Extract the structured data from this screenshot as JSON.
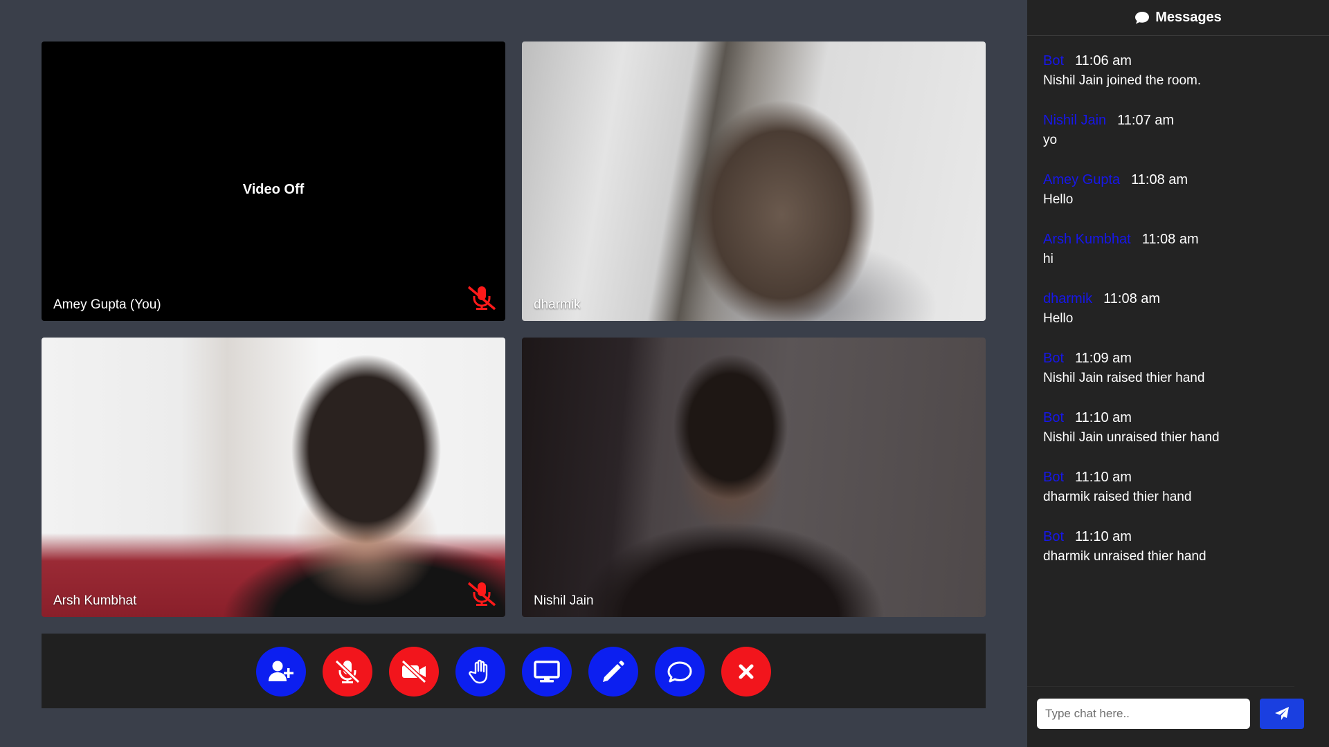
{
  "colors": {
    "page_bg": "#3a3f4a",
    "panel_bg": "#232323",
    "blue_button": "#0c1ff0",
    "red_button": "#f2151c",
    "sender_name": "#1717e8",
    "muted_icon": "#ff1a1a"
  },
  "participants": [
    {
      "name": "Amey Gupta (You)",
      "video_off_label": "Video Off",
      "muted": true
    },
    {
      "name": "dharmik",
      "muted": false
    },
    {
      "name": "Arsh Kumbhat",
      "muted": true
    },
    {
      "name": "Nishil Jain",
      "muted": false
    }
  ],
  "controls": [
    {
      "icon": "add-user-icon",
      "color": "blue"
    },
    {
      "icon": "microphone-slash-icon",
      "color": "red"
    },
    {
      "icon": "video-slash-icon",
      "color": "red"
    },
    {
      "icon": "raise-hand-icon",
      "color": "blue"
    },
    {
      "icon": "screen-share-icon",
      "color": "blue"
    },
    {
      "icon": "pencil-icon",
      "color": "blue"
    },
    {
      "icon": "chat-icon",
      "color": "blue"
    },
    {
      "icon": "close-icon",
      "color": "red"
    }
  ],
  "chat": {
    "title": "Messages",
    "messages": [
      {
        "sender": "Bot",
        "time": "11:06 am",
        "text": "Nishil Jain joined the room."
      },
      {
        "sender": "Nishil Jain",
        "time": "11:07 am",
        "text": "yo"
      },
      {
        "sender": "Amey Gupta",
        "time": "11:08 am",
        "text": "Hello"
      },
      {
        "sender": "Arsh Kumbhat",
        "time": "11:08 am",
        "text": "hi"
      },
      {
        "sender": "dharmik",
        "time": "11:08 am",
        "text": "Hello"
      },
      {
        "sender": "Bot",
        "time": "11:09 am",
        "text": "Nishil Jain raised thier hand"
      },
      {
        "sender": "Bot",
        "time": "11:10 am",
        "text": "Nishil Jain unraised thier hand"
      },
      {
        "sender": "Bot",
        "time": "11:10 am",
        "text": "dharmik raised thier hand"
      },
      {
        "sender": "Bot",
        "time": "11:10 am",
        "text": "dharmik unraised thier hand"
      }
    ],
    "input_placeholder": "Type chat here..",
    "input_value": ""
  }
}
